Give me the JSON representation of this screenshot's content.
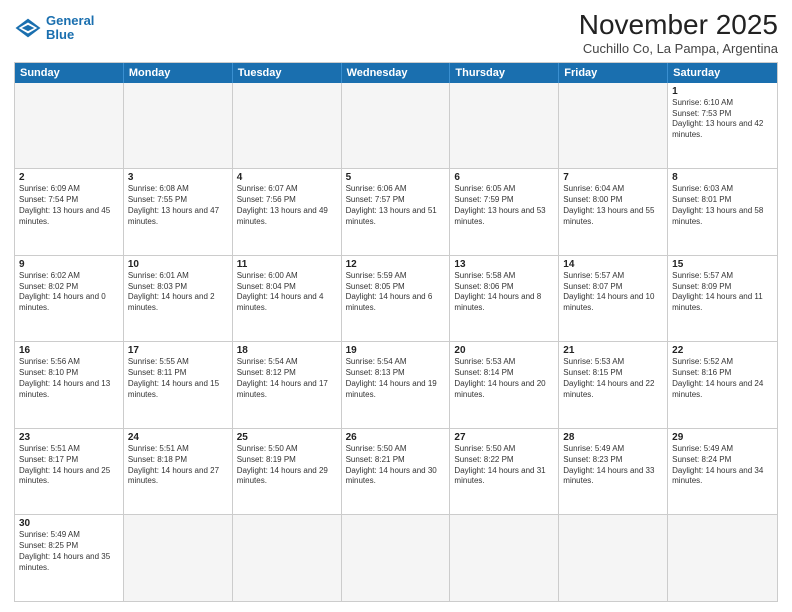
{
  "header": {
    "logo_line1": "General",
    "logo_line2": "Blue",
    "main_title": "November 2025",
    "subtitle": "Cuchillo Co, La Pampa, Argentina"
  },
  "days_of_week": [
    "Sunday",
    "Monday",
    "Tuesday",
    "Wednesday",
    "Thursday",
    "Friday",
    "Saturday"
  ],
  "weeks": [
    [
      {
        "day": "",
        "text": "",
        "empty": true
      },
      {
        "day": "",
        "text": "",
        "empty": true
      },
      {
        "day": "",
        "text": "",
        "empty": true
      },
      {
        "day": "",
        "text": "",
        "empty": true
      },
      {
        "day": "",
        "text": "",
        "empty": true
      },
      {
        "day": "",
        "text": "",
        "empty": true
      },
      {
        "day": "1",
        "text": "Sunrise: 6:10 AM\nSunset: 7:53 PM\nDaylight: 13 hours and 42 minutes."
      }
    ],
    [
      {
        "day": "2",
        "text": "Sunrise: 6:09 AM\nSunset: 7:54 PM\nDaylight: 13 hours and 45 minutes."
      },
      {
        "day": "3",
        "text": "Sunrise: 6:08 AM\nSunset: 7:55 PM\nDaylight: 13 hours and 47 minutes."
      },
      {
        "day": "4",
        "text": "Sunrise: 6:07 AM\nSunset: 7:56 PM\nDaylight: 13 hours and 49 minutes."
      },
      {
        "day": "5",
        "text": "Sunrise: 6:06 AM\nSunset: 7:57 PM\nDaylight: 13 hours and 51 minutes."
      },
      {
        "day": "6",
        "text": "Sunrise: 6:05 AM\nSunset: 7:59 PM\nDaylight: 13 hours and 53 minutes."
      },
      {
        "day": "7",
        "text": "Sunrise: 6:04 AM\nSunset: 8:00 PM\nDaylight: 13 hours and 55 minutes."
      },
      {
        "day": "8",
        "text": "Sunrise: 6:03 AM\nSunset: 8:01 PM\nDaylight: 13 hours and 58 minutes."
      }
    ],
    [
      {
        "day": "9",
        "text": "Sunrise: 6:02 AM\nSunset: 8:02 PM\nDaylight: 14 hours and 0 minutes."
      },
      {
        "day": "10",
        "text": "Sunrise: 6:01 AM\nSunset: 8:03 PM\nDaylight: 14 hours and 2 minutes."
      },
      {
        "day": "11",
        "text": "Sunrise: 6:00 AM\nSunset: 8:04 PM\nDaylight: 14 hours and 4 minutes."
      },
      {
        "day": "12",
        "text": "Sunrise: 5:59 AM\nSunset: 8:05 PM\nDaylight: 14 hours and 6 minutes."
      },
      {
        "day": "13",
        "text": "Sunrise: 5:58 AM\nSunset: 8:06 PM\nDaylight: 14 hours and 8 minutes."
      },
      {
        "day": "14",
        "text": "Sunrise: 5:57 AM\nSunset: 8:07 PM\nDaylight: 14 hours and 10 minutes."
      },
      {
        "day": "15",
        "text": "Sunrise: 5:57 AM\nSunset: 8:09 PM\nDaylight: 14 hours and 11 minutes."
      }
    ],
    [
      {
        "day": "16",
        "text": "Sunrise: 5:56 AM\nSunset: 8:10 PM\nDaylight: 14 hours and 13 minutes."
      },
      {
        "day": "17",
        "text": "Sunrise: 5:55 AM\nSunset: 8:11 PM\nDaylight: 14 hours and 15 minutes."
      },
      {
        "day": "18",
        "text": "Sunrise: 5:54 AM\nSunset: 8:12 PM\nDaylight: 14 hours and 17 minutes."
      },
      {
        "day": "19",
        "text": "Sunrise: 5:54 AM\nSunset: 8:13 PM\nDaylight: 14 hours and 19 minutes."
      },
      {
        "day": "20",
        "text": "Sunrise: 5:53 AM\nSunset: 8:14 PM\nDaylight: 14 hours and 20 minutes."
      },
      {
        "day": "21",
        "text": "Sunrise: 5:53 AM\nSunset: 8:15 PM\nDaylight: 14 hours and 22 minutes."
      },
      {
        "day": "22",
        "text": "Sunrise: 5:52 AM\nSunset: 8:16 PM\nDaylight: 14 hours and 24 minutes."
      }
    ],
    [
      {
        "day": "23",
        "text": "Sunrise: 5:51 AM\nSunset: 8:17 PM\nDaylight: 14 hours and 25 minutes."
      },
      {
        "day": "24",
        "text": "Sunrise: 5:51 AM\nSunset: 8:18 PM\nDaylight: 14 hours and 27 minutes."
      },
      {
        "day": "25",
        "text": "Sunrise: 5:50 AM\nSunset: 8:19 PM\nDaylight: 14 hours and 29 minutes."
      },
      {
        "day": "26",
        "text": "Sunrise: 5:50 AM\nSunset: 8:21 PM\nDaylight: 14 hours and 30 minutes."
      },
      {
        "day": "27",
        "text": "Sunrise: 5:50 AM\nSunset: 8:22 PM\nDaylight: 14 hours and 31 minutes."
      },
      {
        "day": "28",
        "text": "Sunrise: 5:49 AM\nSunset: 8:23 PM\nDaylight: 14 hours and 33 minutes."
      },
      {
        "day": "29",
        "text": "Sunrise: 5:49 AM\nSunset: 8:24 PM\nDaylight: 14 hours and 34 minutes."
      }
    ],
    [
      {
        "day": "30",
        "text": "Sunrise: 5:49 AM\nSunset: 8:25 PM\nDaylight: 14 hours and 35 minutes."
      },
      {
        "day": "",
        "text": "",
        "empty": true
      },
      {
        "day": "",
        "text": "",
        "empty": true
      },
      {
        "day": "",
        "text": "",
        "empty": true
      },
      {
        "day": "",
        "text": "",
        "empty": true
      },
      {
        "day": "",
        "text": "",
        "empty": true
      },
      {
        "day": "",
        "text": "",
        "empty": true
      }
    ]
  ]
}
